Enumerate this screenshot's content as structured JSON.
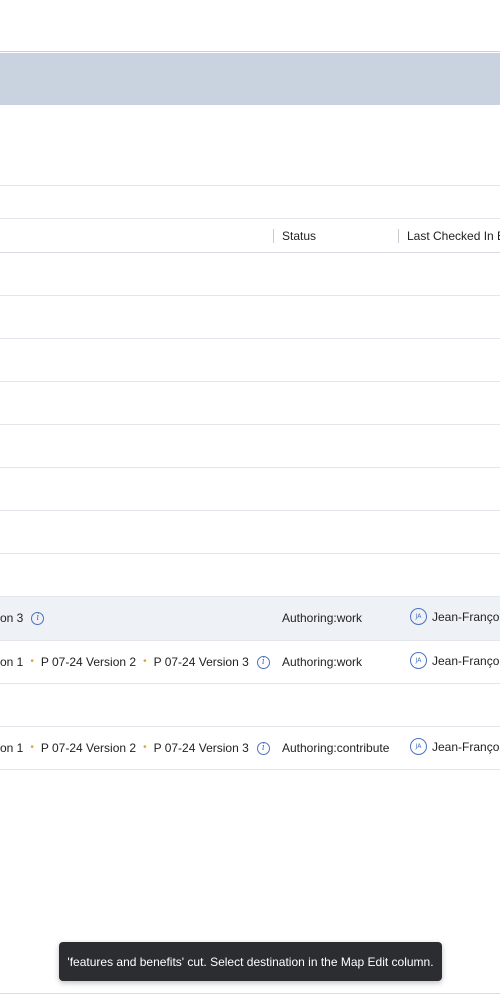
{
  "table": {
    "headers": {
      "status": "Status",
      "last_checked_in_by": "Last Checked In By"
    },
    "rows": [
      {
        "title_parts": [
          "on 3"
        ],
        "status": "Authoring:work",
        "user_initials": "JA",
        "user_name": "Jean-François"
      },
      {
        "title_parts": [
          "on 1",
          "P 07-24 Version 2",
          "P 07-24 Version 3"
        ],
        "status": "Authoring:work",
        "user_initials": "JA",
        "user_name": "Jean-François"
      },
      {
        "title_parts": [
          "on 1",
          "P 07-24 Version 2",
          "P 07-24 Version 3"
        ],
        "status": "Authoring:contribute",
        "user_initials": "JA",
        "user_name": "Jean-François"
      }
    ]
  },
  "toast": {
    "message": "'features and benefits' cut. Select destination in the Map Edit column."
  },
  "colors": {
    "band": "#c9d3df",
    "accent": "#4a72c4",
    "separator_dot": "#e3a33b",
    "toast_bg": "#2b2d31"
  }
}
